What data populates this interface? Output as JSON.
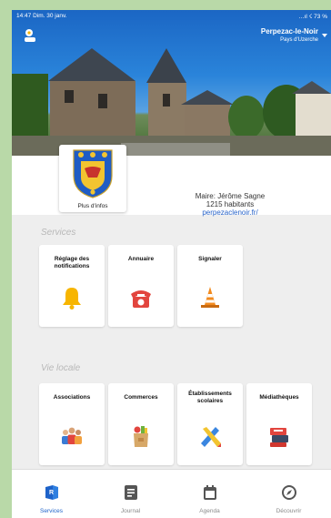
{
  "status_bar": {
    "time_date": "14:47  Dim. 30 janv.",
    "right": "…ıl ☇ 73 %"
  },
  "header": {
    "town_name": "Perpezac-le-Noir",
    "town_sub": "Pays d'Uzerche"
  },
  "crest": {
    "link_label": "Plus d'infos"
  },
  "info": {
    "mayor": "Maire: Jérôme Sagne",
    "population": "1215 habitants",
    "website": "perpezaclenoir.fr/"
  },
  "sections": {
    "services": {
      "title": "Services",
      "tiles": [
        {
          "label": "Réglage des notifications",
          "icon": "bell-icon"
        },
        {
          "label": "Annuaire",
          "icon": "phone-icon"
        },
        {
          "label": "Signaler",
          "icon": "traffic-cone-icon"
        }
      ]
    },
    "vie_locale": {
      "title": "Vie locale",
      "tiles": [
        {
          "label": "Associations",
          "icon": "people-icon"
        },
        {
          "label": "Commerces",
          "icon": "grocery-bag-icon"
        },
        {
          "label": "Établissements scolaires",
          "icon": "pencil-ruler-icon"
        },
        {
          "label": "Médiathèques",
          "icon": "books-icon"
        }
      ]
    }
  },
  "nav": [
    {
      "label": "Services",
      "icon": "services-icon",
      "active": true
    },
    {
      "label": "Journal",
      "icon": "journal-icon",
      "active": false
    },
    {
      "label": "Agenda",
      "icon": "calendar-icon",
      "active": false
    },
    {
      "label": "Découvrir",
      "icon": "compass-icon",
      "active": false
    }
  ],
  "colors": {
    "accent": "#1d62c9",
    "link": "#2763c9",
    "background": "#eeeeee",
    "bell": "#f7b500",
    "phone": "#e2453e",
    "cone": "#f28a1e"
  }
}
